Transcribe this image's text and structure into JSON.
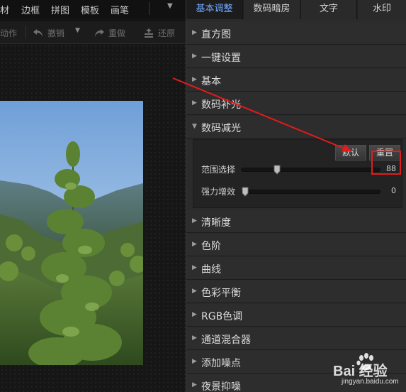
{
  "menubar": {
    "items": [
      "材",
      "边框",
      "拼图",
      "模板",
      "画笔"
    ],
    "more_icon": "chevron-down-icon"
  },
  "toolbar": {
    "action_label": "动作",
    "undo_label": "撤销",
    "redo_label": "重做",
    "restore_label": "还原"
  },
  "panel": {
    "tabs": [
      {
        "label": "基本调整",
        "active": true
      },
      {
        "label": "数码暗房",
        "active": false
      },
      {
        "label": "文字",
        "active": false
      },
      {
        "label": "水印",
        "active": false
      }
    ],
    "sections_top": [
      "直方图",
      "一键设置",
      "基本",
      "数码补光"
    ],
    "expanded": {
      "title": "数码减光",
      "default_button": "默认",
      "reset_button": "重置",
      "sliders": [
        {
          "label": "范围选择",
          "value": "88",
          "fraction": 0.24
        },
        {
          "label": "强力增效",
          "value": "0",
          "fraction": 0.0
        }
      ]
    },
    "sections_bottom": [
      "清晰度",
      "色阶",
      "曲线",
      "色彩平衡",
      "RGB色调",
      "通道混合器",
      "添加噪点",
      "夜景抑噪"
    ]
  },
  "watermark": {
    "logo_text": "Bai 经验",
    "url": "jingyan.baidu.com"
  },
  "colors": {
    "accent_tab": "#6fa8ff",
    "annotation_red": "#e31b1b",
    "panel_bg": "#2b2b2b"
  }
}
